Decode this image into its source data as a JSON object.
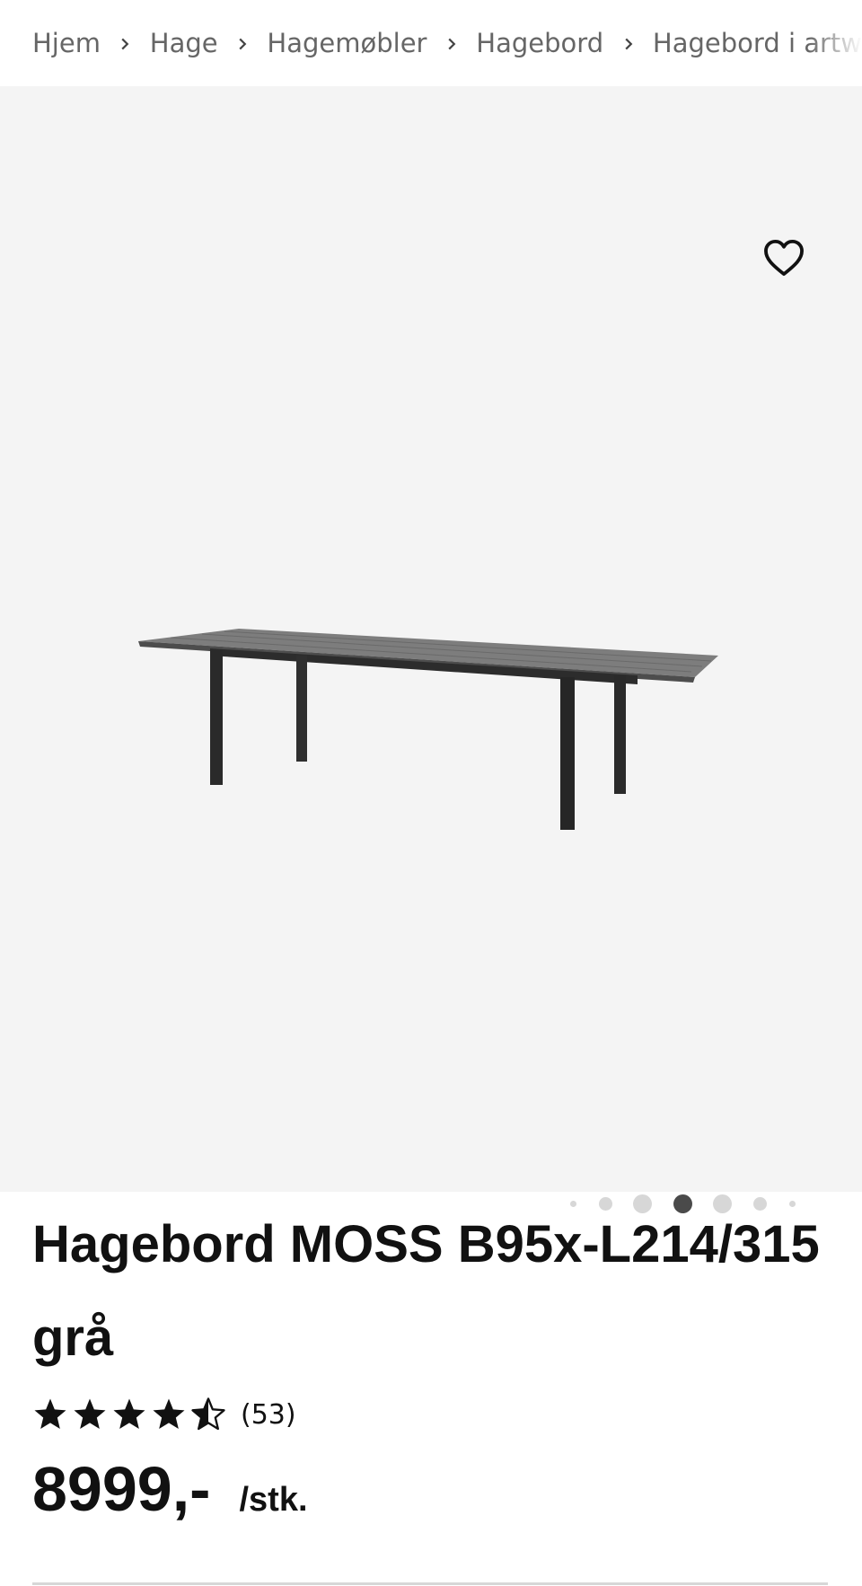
{
  "breadcrumb": {
    "items": [
      {
        "label": "Hjem"
      },
      {
        "label": "Hage"
      },
      {
        "label": "Hagemøbler"
      },
      {
        "label": "Hagebord"
      },
      {
        "label": "Hagebord i artw"
      }
    ],
    "separator_icon": "chevron-right-icon"
  },
  "gallery": {
    "wishlist_icon": "heart-outline-icon",
    "background_color": "#f4f4f4",
    "slide_count": 7,
    "active_slide": 4
  },
  "product": {
    "title": "Hagebord MOSS B95x-L214/315 grå",
    "rating": {
      "value": 4.5,
      "max": 5,
      "count_label": "(53)"
    },
    "price": "8999,-",
    "unit": "/stk."
  },
  "colors": {
    "text": "#111111",
    "muted": "#666666",
    "dot_inactive": "#d7d7d7",
    "dot_active": "#4a4a4a"
  }
}
